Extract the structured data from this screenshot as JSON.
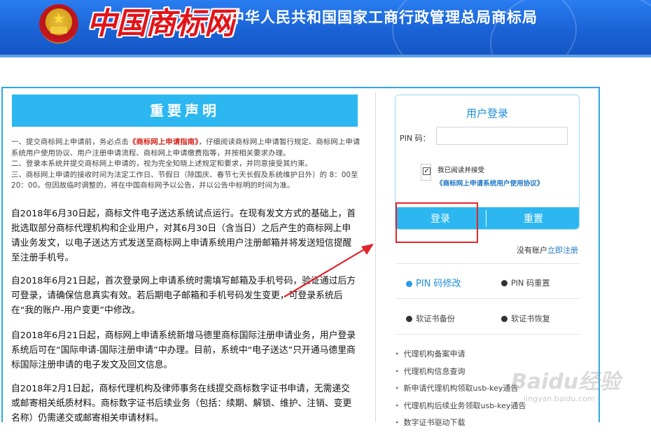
{
  "header": {
    "logo_text": "中国商标网",
    "title": "中华人民共和国国家工商行政管理总局商标局"
  },
  "notice": {
    "banner": "重要声明",
    "line1_pre": "一、提交商标网上申请前，务必点击",
    "line1_link": "《商标网上申请指南》",
    "line1_post": "，仔细阅读商标网上申请暂行规定、商标网上申请系统用户使用协议、用户注册申请流程、商标网上申请缴费指等，并按相关要求办理。",
    "line2": "二、登录本系统并提交商标网上申请的，视为完全知晓上述规定和要求，并同意接受其约束。",
    "line3": "三、商标网上申请的接收时间为法定工作日、节假日（除国庆、春节七天长假及系统维护日外）的 8：00至20：00。但因故临时调整的，将在中国商标网予以公告，并以公告中标明的时间为准。"
  },
  "paragraphs": [
    "自2018年6月30日起，商标文件电子送达系统试点运行。在现有发文方式的基础上，首批选取部分商标代理机构和企业用户，对其6月30日（含当日）之后产生的商标网上申请业务发文，以电子送达方式发送至商标网上申请系统用户注册邮箱并将发送短信提醒至注册手机号。",
    "自2018年6月21日起，首次登录网上申请系统时需填写邮箱及手机号码，验证通过后方可登录，请确保信息真实有效。若后期电子邮箱和手机号码发生变更，可登录系统后在“我的账户-用户变更”中修改。",
    "自2018年6月21日起，商标网上申请系统新增马德里商标国际注册申请业务，用户登录系统后可在“国际申请-国际注册申请”中办理。目前，系统中“电子送达”只开通马德里商标国际注册申请的电子发文及回文信息。",
    "自2018年2月1日起，商标代理机构及律师事务在线提交商标数字证书申请，无需递交或邮寄相关纸质材料。商标数字证书后续业务（包括：续期、解锁、维护、注销、变更名称）仍需递交或邮寄相关申请材料。"
  ],
  "login": {
    "title": "用户登录",
    "pin_label": "PIN 码：",
    "pin_value": "",
    "agree_text": "我已阅读并接受",
    "agree_link": "《商标网上申请系统用户使用协议》",
    "agree_checked": "✓",
    "login_button": "登录",
    "reset_button": "重置",
    "no_account": "没有账户",
    "register_link": "立即注册"
  },
  "tools": {
    "pin_edit": "PIN 码修改",
    "pin_reset": "PIN 码重置",
    "cert_backup": "软证书备份",
    "cert_restore": "软证书恢复"
  },
  "side_links": [
    "代理机构备案申请",
    "代理机构信息查询",
    "新申请代理机构领取usb-key通告",
    "代理机构后续业务领取usb-key通告",
    "数字证书驱动下载"
  ],
  "watermark": {
    "brand": "Baidu经验",
    "url": "jingyan.baidu.com"
  },
  "colors": {
    "accent": "#2cb7f0",
    "header": "#1a63d6",
    "highlight": "#e0262c",
    "link": "#1f78c4"
  }
}
